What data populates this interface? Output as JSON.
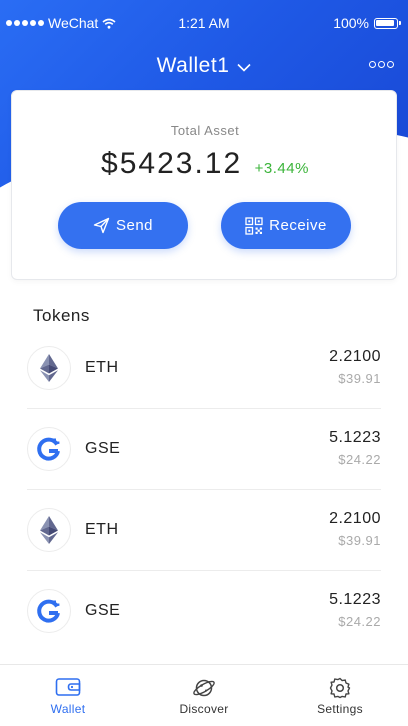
{
  "status_bar": {
    "carrier": "WeChat",
    "time": "1:21 AM",
    "battery": "100%"
  },
  "header": {
    "wallet_name": "Wallet1"
  },
  "asset_card": {
    "label": "Total Asset",
    "total": "$5423.12",
    "change": "+3.44%",
    "send_label": "Send",
    "receive_label": "Receive"
  },
  "tokens": {
    "title": "Tokens",
    "items": [
      {
        "symbol": "ETH",
        "amount": "2.2100",
        "value": "$39.91",
        "icon": "ethereum-icon"
      },
      {
        "symbol": "GSE",
        "amount": "5.1223",
        "value": "$24.22",
        "icon": "gse-icon"
      },
      {
        "symbol": "ETH",
        "amount": "2.2100",
        "value": "$39.91",
        "icon": "ethereum-icon"
      },
      {
        "symbol": "GSE",
        "amount": "5.1223",
        "value": "$24.22",
        "icon": "gse-icon"
      }
    ]
  },
  "tabbar": {
    "items": [
      {
        "label": "Wallet",
        "icon": "wallet-icon",
        "active": true
      },
      {
        "label": "Discover",
        "icon": "planet-icon",
        "active": false
      },
      {
        "label": "Settings",
        "icon": "gear-icon",
        "active": false
      }
    ]
  },
  "colors": {
    "primary": "#3471f0",
    "positive": "#3bb43a",
    "muted": "#aaaaaa"
  }
}
